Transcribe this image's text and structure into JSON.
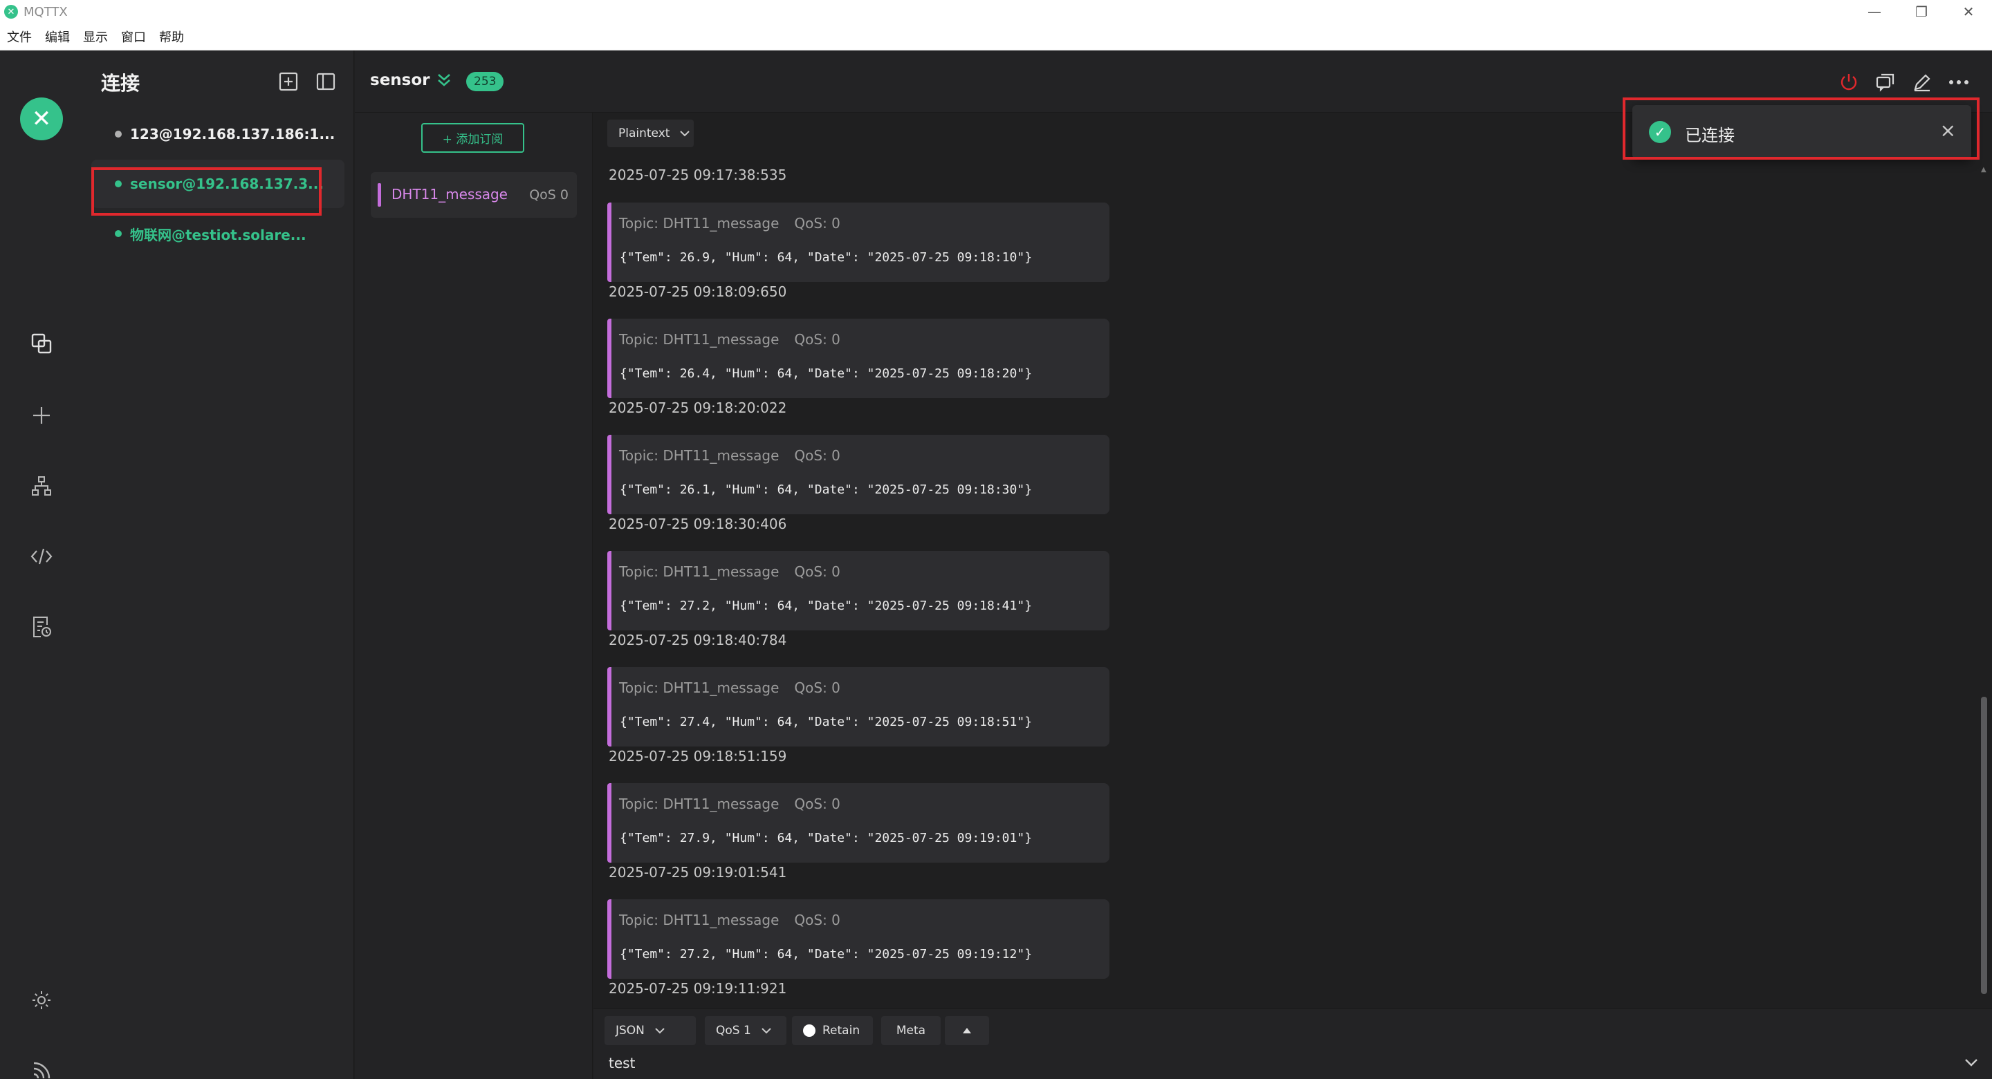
{
  "window": {
    "title": "MQTTX",
    "controls": {
      "minimize": "—",
      "restore": "❐",
      "close": "✕"
    }
  },
  "menu": [
    "文件",
    "编辑",
    "显示",
    "窗口",
    "帮助"
  ],
  "colors": {
    "accent": "#35c28b",
    "topic": "#c46ddb",
    "highlight_box": "#e0282d",
    "disconnect_icon": "#e0282d"
  },
  "nav_icons": [
    "connections-icon",
    "add-icon",
    "topology-icon",
    "script-icon",
    "log-icon",
    "settings-icon",
    "feed-icon"
  ],
  "connections": {
    "title": "连接",
    "items": [
      {
        "label": "123@192.168.137.186:1...",
        "status": "disconnected"
      },
      {
        "label": "sensor@192.168.137.3...",
        "status": "connected"
      },
      {
        "label": "物联网@testiot.solare...",
        "status": "connected"
      }
    ]
  },
  "header": {
    "connection_name": "sensor",
    "message_count": "253"
  },
  "subscriptions": {
    "add_label": "+ 添加订阅",
    "items": [
      {
        "topic": "DHT11_message",
        "qos": "QoS 0"
      }
    ]
  },
  "messages": {
    "format": "Plaintext",
    "top_timestamp": "2025-07-25 09:17:38:535",
    "items": [
      {
        "topic": "Topic: DHT11_message",
        "qos": "QoS: 0",
        "payload": "{\"Tem\": 26.9, \"Hum\": 64, \"Date\": \"2025-07-25 09:18:10\"}",
        "time": "2025-07-25 09:18:09:650"
      },
      {
        "topic": "Topic: DHT11_message",
        "qos": "QoS: 0",
        "payload": "{\"Tem\": 26.4, \"Hum\": 64, \"Date\": \"2025-07-25 09:18:20\"}",
        "time": "2025-07-25 09:18:20:022"
      },
      {
        "topic": "Topic: DHT11_message",
        "qos": "QoS: 0",
        "payload": "{\"Tem\": 26.1, \"Hum\": 64, \"Date\": \"2025-07-25 09:18:30\"}",
        "time": "2025-07-25 09:18:30:406"
      },
      {
        "topic": "Topic: DHT11_message",
        "qos": "QoS: 0",
        "payload": "{\"Tem\": 27.2, \"Hum\": 64, \"Date\": \"2025-07-25 09:18:41\"}",
        "time": "2025-07-25 09:18:40:784"
      },
      {
        "topic": "Topic: DHT11_message",
        "qos": "QoS: 0",
        "payload": "{\"Tem\": 27.4, \"Hum\": 64, \"Date\": \"2025-07-25 09:18:51\"}",
        "time": "2025-07-25 09:18:51:159"
      },
      {
        "topic": "Topic: DHT11_message",
        "qos": "QoS: 0",
        "payload": "{\"Tem\": 27.9, \"Hum\": 64, \"Date\": \"2025-07-25 09:19:01\"}",
        "time": "2025-07-25 09:19:01:541"
      },
      {
        "topic": "Topic: DHT11_message",
        "qos": "QoS: 0",
        "payload": "{\"Tem\": 27.2, \"Hum\": 64, \"Date\": \"2025-07-25 09:19:12\"}",
        "time": "2025-07-25 09:19:11:921"
      }
    ]
  },
  "publish": {
    "format": "JSON",
    "qos": "QoS 1",
    "retain": "Retain",
    "meta": "Meta",
    "topic_value": "test"
  },
  "toast": {
    "message": "已连接"
  }
}
